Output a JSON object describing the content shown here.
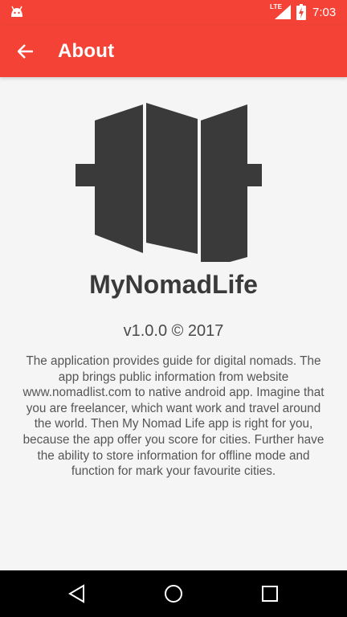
{
  "status_bar": {
    "time": "7:03",
    "network_label": "LTE",
    "icons": [
      "android-icon",
      "signal-icon",
      "battery-icon"
    ]
  },
  "app_bar": {
    "title": "About",
    "back_icon": "arrow-left-icon"
  },
  "about": {
    "logo_text": "MyNomadLife",
    "version": "v1.0.0 © 2017",
    "description": "The application provides guide for digital nomads. The app brings public information from website www.nomadlist.com to native android app. Imagine that you are freelancer, which want work and travel around the world. Then My Nomad Life app is right for you, because the app offer you score for cities. Further have the ability to store information for offline mode and function for mark your favourite cities."
  },
  "nav_bar": {
    "buttons": [
      "back-triangle-icon",
      "home-circle-icon",
      "recents-square-icon"
    ]
  },
  "colors": {
    "primary": "#f44336",
    "logo": "#3a3a3a",
    "background": "#f5f5f5",
    "text": "#555555"
  }
}
